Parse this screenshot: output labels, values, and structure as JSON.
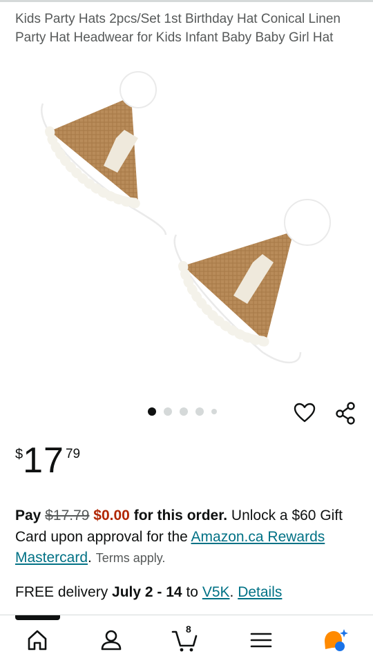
{
  "product": {
    "title": "Kids Party Hats 2pcs/Set 1st Birthday Hat Conical Linen Party Hat Headwear for Kids Infant Baby Baby Girl Hat"
  },
  "carousel": {
    "total": 5,
    "active_index": 0
  },
  "price": {
    "symbol": "$",
    "whole": "17",
    "fraction": "79"
  },
  "promo": {
    "pay_label": "Pay",
    "original_price": "$17.79",
    "new_price": "$0.00",
    "for_this_order": "for this order.",
    "unlock_text": "Unlock a $60 Gift Card upon approval for the",
    "card_link": "Amazon.ca Rewards Mastercard",
    "period": ".",
    "terms": "Terms apply."
  },
  "delivery": {
    "prefix": "FREE delivery",
    "dates": "July 2 - 14",
    "to_label": "to",
    "postal_code": "V5K",
    "period": ".",
    "details_link": "Details"
  },
  "navbar": {
    "cart_count": "8",
    "items": [
      "home-icon",
      "account-icon",
      "cart-icon",
      "menu-icon",
      "rufus-icon"
    ]
  },
  "colors": {
    "link": "#007185",
    "deal_price": "#b12704",
    "text": "#0f1111",
    "muted": "#565959",
    "rufus_orange": "#ff8a00",
    "rufus_blue": "#1a73e8"
  }
}
